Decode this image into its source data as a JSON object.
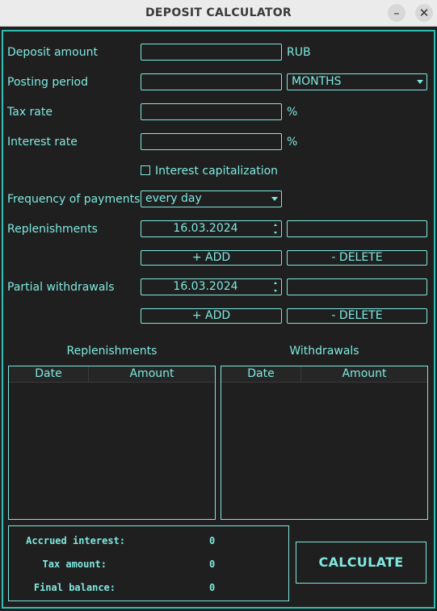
{
  "window": {
    "title": "DEPOSIT CALCULATOR",
    "minimize_label": "–",
    "close_label": "✕"
  },
  "form": {
    "deposit_amount": {
      "label": "Deposit amount",
      "value": "",
      "unit": "RUB"
    },
    "posting_period": {
      "label": "Posting period",
      "value": "",
      "unit_selected": "MONTHS"
    },
    "tax_rate": {
      "label": "Tax rate",
      "value": "",
      "unit": "%"
    },
    "interest_rate": {
      "label": "Interest rate",
      "value": "",
      "unit": "%"
    },
    "capitalization": {
      "label": "Interest capitalization",
      "checked": false
    },
    "frequency": {
      "label": "Frequency of payments",
      "selected": "every day"
    },
    "replenishments": {
      "label": "Replenishments",
      "date": "16.03.2024",
      "amount": "",
      "add_label": "+ ADD",
      "delete_label": "- DELETE"
    },
    "withdrawals": {
      "label": "Partial withdrawals",
      "date": "16.03.2024",
      "amount": "",
      "add_label": "+ ADD",
      "delete_label": "- DELETE"
    }
  },
  "tables": {
    "replenishments": {
      "title": "Replenishments",
      "columns": [
        "Date",
        "Amount"
      ],
      "rows": []
    },
    "withdrawals": {
      "title": "Withdrawals",
      "columns": [
        "Date",
        "Amount"
      ],
      "rows": []
    }
  },
  "results": {
    "accrued_interest": {
      "label": "Accrued interest:",
      "value": "0"
    },
    "tax_amount": {
      "label": "Tax amount:",
      "value": "0"
    },
    "final_balance": {
      "label": "Final balance:",
      "value": "0"
    }
  },
  "calculate_label": "CALCULATE",
  "colors": {
    "accent": "#7fe8e0",
    "frame": "#2fbfb5",
    "background": "#1f1f1f",
    "titlebar": "#ebebeb"
  }
}
